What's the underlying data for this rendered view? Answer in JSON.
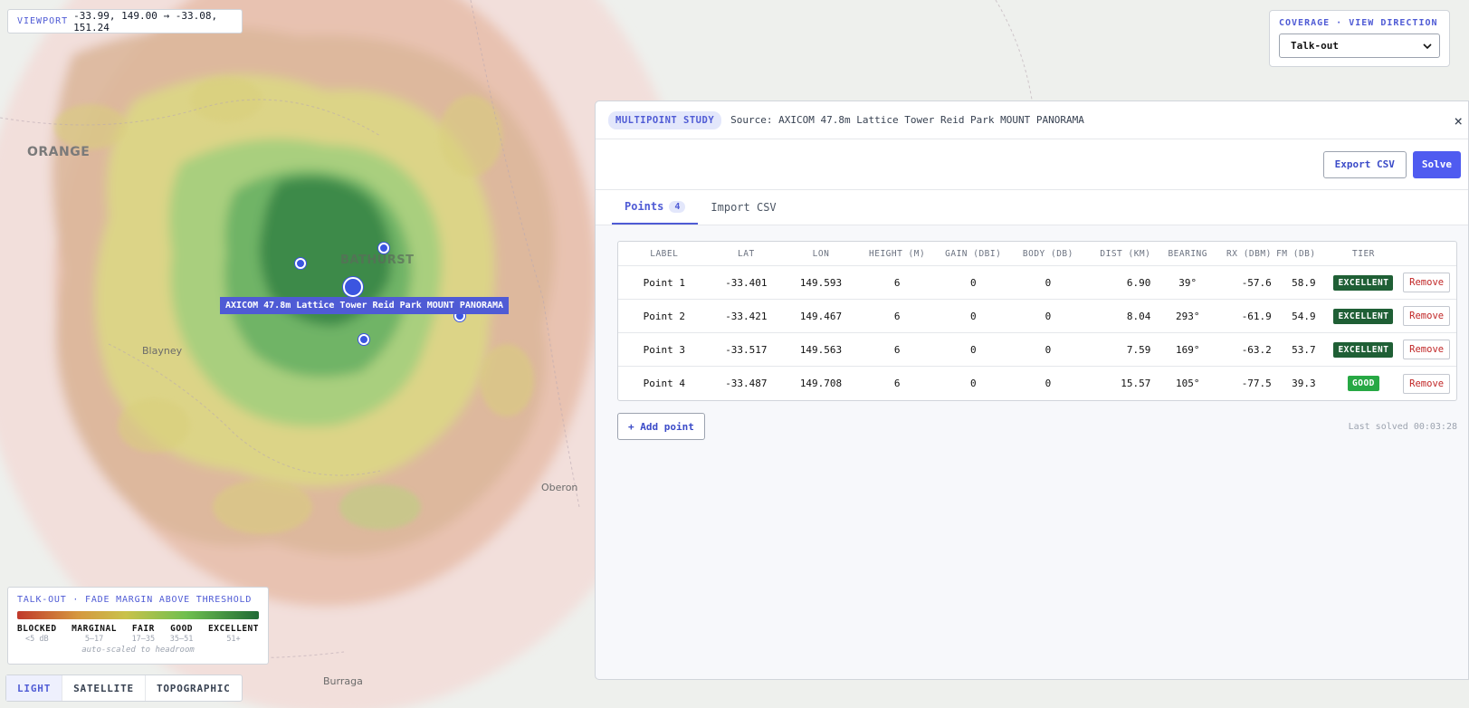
{
  "viewport": {
    "label": "VIEWPORT",
    "value": "-33.99, 149.00 → -33.08, 151.24"
  },
  "coverage": {
    "title": "COVERAGE · VIEW DIRECTION",
    "selected": "Talk-out"
  },
  "map": {
    "places": [
      "ORANGE",
      "BATHURST",
      "Blayney",
      "Oberon",
      "Burraga"
    ],
    "transmitter_label": "AXICOM 47.8m Lattice Tower Reid Park MOUNT PANORAMA"
  },
  "legend": {
    "title": "TALK-OUT · FADE MARGIN ABOVE THRESHOLD",
    "tiers": [
      {
        "name": "BLOCKED",
        "range": "<5 dB"
      },
      {
        "name": "MARGINAL",
        "range": "5–17"
      },
      {
        "name": "FAIR",
        "range": "17–35"
      },
      {
        "name": "GOOD",
        "range": "35–51"
      },
      {
        "name": "EXCELLENT",
        "range": "51+"
      }
    ],
    "footnote": "auto-scaled to headroom"
  },
  "basemap": {
    "options": [
      "LIGHT",
      "SATELLITE",
      "TOPOGRAPHIC"
    ],
    "active": "LIGHT"
  },
  "panel": {
    "badge": "MULTIPOINT STUDY",
    "source": "Source: AXICOM 47.8m Lattice Tower Reid Park MOUNT PANORAMA",
    "close": "×",
    "export_label": "Export CSV",
    "solve_label": "Solve",
    "tabs": [
      {
        "label": "Points",
        "count": "4"
      },
      {
        "label": "Import CSV"
      }
    ],
    "columns": [
      "LABEL",
      "LAT",
      "LON",
      "HEIGHT (M)",
      "GAIN (DBI)",
      "BODY (DB)",
      "DIST (KM)",
      "BEARING",
      "RX (DBM)",
      "FM (DB)",
      "TIER"
    ],
    "rows": [
      {
        "label": "Point 1",
        "lat": "-33.401",
        "lon": "149.593",
        "height": "6",
        "gain": "0",
        "body": "0",
        "dist": "6.90",
        "bearing": "39°",
        "rx": "-57.6",
        "fm": "58.9",
        "tier": "EXCELLENT",
        "remove": "Remove"
      },
      {
        "label": "Point 2",
        "lat": "-33.421",
        "lon": "149.467",
        "height": "6",
        "gain": "0",
        "body": "0",
        "dist": "8.04",
        "bearing": "293°",
        "rx": "-61.9",
        "fm": "54.9",
        "tier": "EXCELLENT",
        "remove": "Remove"
      },
      {
        "label": "Point 3",
        "lat": "-33.517",
        "lon": "149.563",
        "height": "6",
        "gain": "0",
        "body": "0",
        "dist": "7.59",
        "bearing": "169°",
        "rx": "-63.2",
        "fm": "53.7",
        "tier": "EXCELLENT",
        "remove": "Remove"
      },
      {
        "label": "Point 4",
        "lat": "-33.487",
        "lon": "149.708",
        "height": "6",
        "gain": "0",
        "body": "0",
        "dist": "15.57",
        "bearing": "105°",
        "rx": "-77.5",
        "fm": "39.3",
        "tier": "GOOD",
        "remove": "Remove"
      }
    ],
    "add_label": "+ Add point",
    "last_solved": "Last solved 00:03:28"
  },
  "colors": {
    "accent": "#4f5bd5",
    "excellent": "#1f5f35",
    "good": "#27a844",
    "remove": "#c02626"
  }
}
